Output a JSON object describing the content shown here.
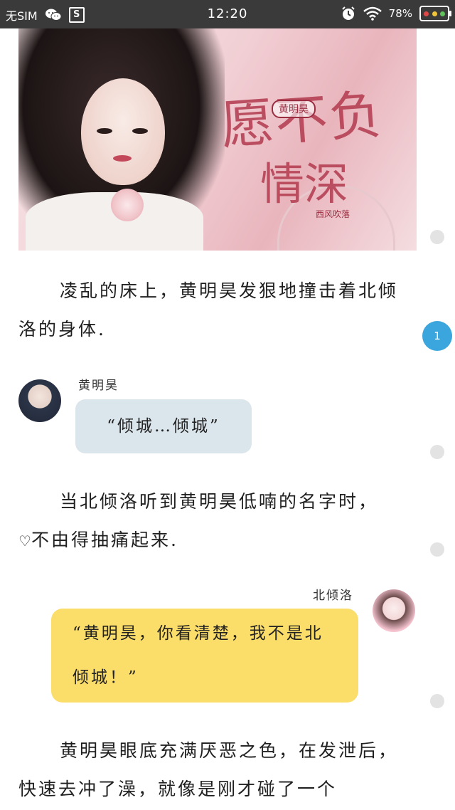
{
  "status_bar": {
    "carrier": "无SIM",
    "time": "12:20",
    "battery_text": "78%",
    "icons": [
      "wechat-icon",
      "s-box-icon",
      "alarm-icon",
      "wifi-icon",
      "battery-icon"
    ]
  },
  "cover": {
    "stamp": "黄明昊",
    "calligraphy_line1": "愿不负",
    "calligraphy_line2": "情深",
    "small_caption": "西风吹落"
  },
  "scroll_indicator": {
    "active_label": "1"
  },
  "story": {
    "para1": "凌乱的床上，黄明昊发狠地撞击着北倾洛的身体.",
    "msg1_speaker": "黄明昊",
    "msg1_text": "“倾城…倾城”",
    "para2_line1": "当北倾洛听到黄明昊低喃的名字时，",
    "para2_line2": "不由得抽痛起来.",
    "msg2_speaker": "北倾洛",
    "msg2_text": "“黄明昊，你看清楚，我不是北倾城！”",
    "para3": "黄明昊眼底充满厌恶之色，在发泄后，快速去冲了澡，就像是刚才碰了一个"
  },
  "colors": {
    "status_bar_bg": "#3a3a3a",
    "bubble_male": "#dbe5ec",
    "bubble_female": "#fbdd6a",
    "scroll_active": "#3aa6dd",
    "scroll_idle": "#e3e3e3"
  }
}
